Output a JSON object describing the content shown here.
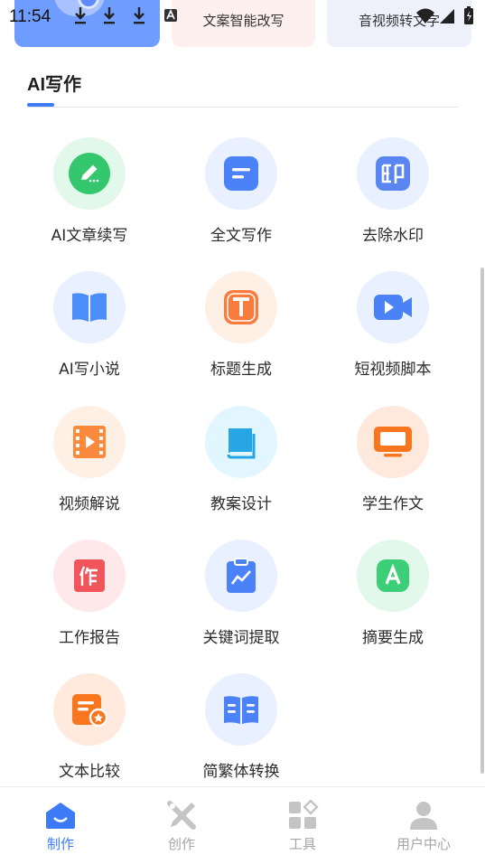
{
  "status_bar": {
    "time": "11:54"
  },
  "promo_cards": [
    {
      "subtitle": "",
      "color": "#6f9cff"
    },
    {
      "subtitle": "文案智能改写",
      "color": "#fff0f0"
    },
    {
      "subtitle": "音视频转文字",
      "color": "#eef0fc"
    }
  ],
  "section": {
    "title": "AI写作",
    "accent": "#3d7bf6"
  },
  "tools": [
    {
      "label": "AI文章续写",
      "icon": "pencil-icon",
      "bg": "#e2f8ea",
      "fg": "#34c76e"
    },
    {
      "label": "全文写作",
      "icon": "document-icon",
      "bg": "#e9f0ff",
      "fg": "#4c82f7"
    },
    {
      "label": "去除水印",
      "icon": "stamp-icon",
      "bg": "#e9f0ff",
      "fg": "#5b86f2"
    },
    {
      "label": "AI写小说",
      "icon": "book-icon",
      "bg": "#e9f0ff",
      "fg": "#4c8ef7"
    },
    {
      "label": "标题生成",
      "icon": "title-t-icon",
      "bg": "#fff0e6",
      "fg": "#fb7a3e"
    },
    {
      "label": "短视频脚本",
      "icon": "video-camera-icon",
      "bg": "#e9f0ff",
      "fg": "#4c82f7"
    },
    {
      "label": "视频解说",
      "icon": "film-icon",
      "bg": "#fff0e6",
      "fg": "#fb8a3c"
    },
    {
      "label": "教案设计",
      "icon": "textbook-icon",
      "bg": "#e2f6ff",
      "fg": "#27a6e6"
    },
    {
      "label": "学生作文",
      "icon": "monitor-icon",
      "bg": "#ffe9dd",
      "fg": "#f7761e"
    },
    {
      "label": "工作报告",
      "icon": "report-icon",
      "bg": "#ffe8ea",
      "fg": "#f2545b"
    },
    {
      "label": "关键词提取",
      "icon": "clipboard-chart-icon",
      "bg": "#e9f0ff",
      "fg": "#4c82f7"
    },
    {
      "label": "摘要生成",
      "icon": "summary-a-icon",
      "bg": "#e2f8ea",
      "fg": "#3ccf78"
    },
    {
      "label": "文本比较",
      "icon": "compare-doc-icon",
      "bg": "#ffeadd",
      "fg": "#f7761e"
    },
    {
      "label": "简繁体转换",
      "icon": "open-book-icon",
      "bg": "#e9f0ff",
      "fg": "#4c82f7"
    }
  ],
  "bottom_nav": [
    {
      "label": "制作",
      "icon": "home-icon",
      "active": true
    },
    {
      "label": "创作",
      "icon": "tools-icon",
      "active": false
    },
    {
      "label": "工具",
      "icon": "grid-icon",
      "active": false
    },
    {
      "label": "用户中心",
      "icon": "user-icon",
      "active": false
    }
  ]
}
